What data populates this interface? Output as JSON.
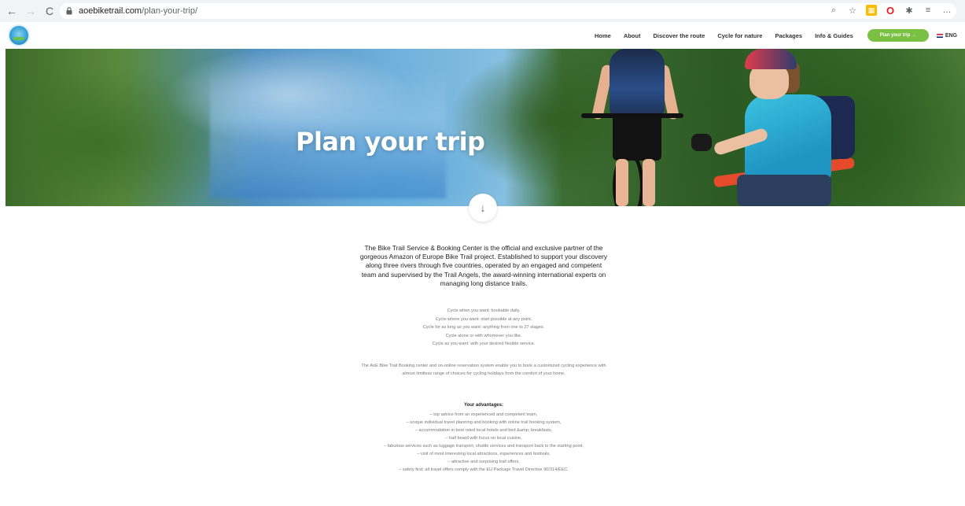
{
  "browser": {
    "url_host": "aoebiketrail.com",
    "url_path": "/plan-your-trip/"
  },
  "header": {
    "nav": [
      "Home",
      "About",
      "Discover the route",
      "Cycle for nature",
      "Packages",
      "Info & Guides"
    ],
    "cta_label": "Plan your trip →",
    "lang_label": "ENG",
    "accent_color": "#7ac143"
  },
  "hero": {
    "title": "Plan your trip"
  },
  "content": {
    "intro": "The Bike Trail Service & Booking Center is the official and exclusive partner of the gorgeous Amazon of Europe Bike Trail project. Established to support your discovery along three rivers through five countries, operated by an engaged and competent team and supervised by the Trail Angels, the award-winning international experts on  managing long distance trails.",
    "cycle_lines": [
      "Cycle when you want: bookable daily.",
      "Cycle where you want: start possible at any point.",
      "Cycle for as long as you want: anything from one to 27 stages.",
      "Cycle alone or with whomever you like.",
      "Cycle as you want: with your desired flexible service."
    ],
    "booking_text": "The AoE Bike Trail Booking center and on-online reservation system enable you to book a customized cycling experience with almost limitless range of choices for cycling holidays from the comfort of your home.",
    "advantages_title": "Your advantages:",
    "advantages": [
      "– top advice from an experienced and competent team,",
      "– unique individual travel planning and booking with online trail booking system,",
      "– accommodation in best rated local hotels and bed &amp; breakfasts,",
      "– half board with focus on local cuisine,",
      "– fabulous services such as luggage transport, shuttle services and transport back to the starting point,",
      "– visit of most interesting local attractions, experiences and festivals,",
      "– attractive and surprising trail offers,",
      "– safety first: all travel offers comply with the EU Package Travel Directive 90/314/EEC."
    ]
  },
  "icons": {
    "back": "back-arrow-icon",
    "forward": "forward-arrow-icon",
    "reload": "reload-icon",
    "lock": "lock-icon",
    "scroll": "arrow-down-icon"
  }
}
